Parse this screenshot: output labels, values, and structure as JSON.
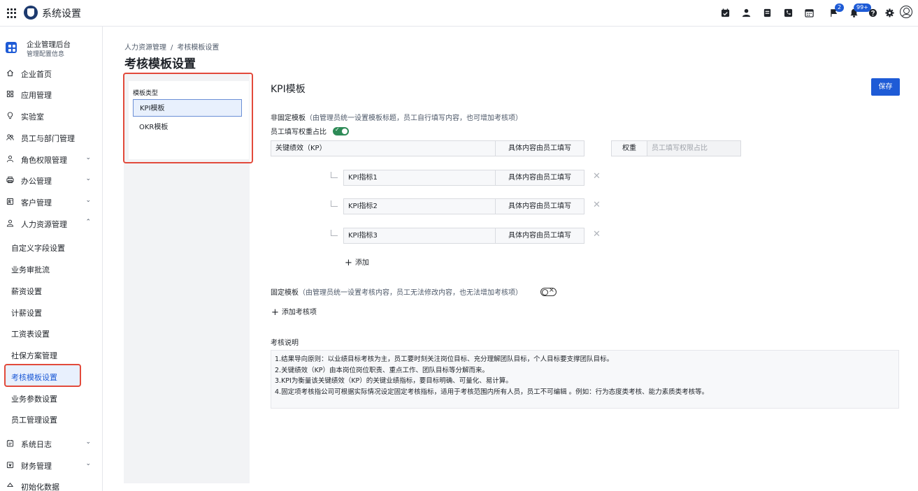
{
  "app": {
    "title": "系统设置"
  },
  "topbar": {
    "icons": [
      "calendar-check-icon",
      "person-icon",
      "document-icon",
      "phone-icon",
      "calendar-grid-icon",
      "flag-icon",
      "bell-icon",
      "help-icon",
      "gear-icon",
      "avatar-icon"
    ],
    "flag_badge": "2",
    "bell_badge": "99+"
  },
  "sidebar": {
    "org_name": "企业管理后台",
    "org_sub": "管理配置信息",
    "items": [
      {
        "label": "企业首页",
        "icon": "home-icon",
        "chevron": ""
      },
      {
        "label": "应用管理",
        "icon": "apps-icon",
        "chevron": ""
      },
      {
        "label": "实验室",
        "icon": "bulb-icon",
        "chevron": ""
      },
      {
        "label": "员工与部门管理",
        "icon": "people-icon",
        "chevron": ""
      },
      {
        "label": "角色权限管理",
        "icon": "role-icon",
        "chevron": "⌄"
      },
      {
        "label": "办公管理",
        "icon": "printer-icon",
        "chevron": "⌄"
      },
      {
        "label": "客户管理",
        "icon": "contact-card-icon",
        "chevron": "⌄"
      },
      {
        "label": "人力资源管理",
        "icon": "hr-icon",
        "chevron": "⌃"
      }
    ],
    "sub_items": [
      {
        "label": "自定义字段设置"
      },
      {
        "label": "业务审批流"
      },
      {
        "label": "薪资设置"
      },
      {
        "label": "计薪设置"
      },
      {
        "label": "工资表设置"
      },
      {
        "label": "社保方案管理"
      },
      {
        "label": "考核模板设置"
      },
      {
        "label": "业务参数设置"
      },
      {
        "label": "员工管理设置"
      }
    ],
    "bottom_items": [
      {
        "label": "系统日志",
        "icon": "log-icon",
        "chevron": "⌄"
      },
      {
        "label": "财务管理",
        "icon": "finance-icon",
        "chevron": "⌄"
      },
      {
        "label": "初始化数据",
        "icon": "init-icon",
        "chevron": ""
      }
    ]
  },
  "breadcrumb": {
    "parent": "人力资源管理",
    "separator": "/",
    "current": "考核模板设置"
  },
  "page_title": "考核模板设置",
  "template_types": {
    "label": "模板类型",
    "options": [
      "KPI模板",
      "OKR模板"
    ]
  },
  "kpi": {
    "title": "KPI模板",
    "save_label": "保存",
    "nonfixed_title": "非固定模板",
    "nonfixed_hint": "（由管理员统一设置模板标题，员工自行填写内容，也可增加考核项）",
    "weight_toggle_label": "员工填写权重占比",
    "key_perf": "关键绩效（KP）",
    "fill_by_employee": "具体内容由员工填写",
    "weight_label": "权重",
    "weight_placeholder": "员工填写权限占比",
    "indicators": [
      "KPI指标1",
      "KPI指标2",
      "KPI指标3"
    ],
    "add_label": "添加",
    "fixed_title": "固定模板",
    "fixed_hint": "（由管理员统一设置考核内容，员工无法修改内容，也无法增加考核项）",
    "add_item_label": "添加考核项",
    "desc_title": "考核说明",
    "desc_lines": [
      "1.结果导向原则：以业绩目标考核为主，员工要时刻关注岗位目标、充分理解团队目标，个人目标要支撑团队目标。",
      "2.关键绩效（KP）由本岗位岗位职责、重点工作、团队目标等分解而来。",
      "3.KPI为衡量该关键绩效（KP）的关键业绩指标，要目标明确、可量化、易计算。",
      "4.固定项考核指公司可根据实际情况设定固定考核指标，适用于考核范围内所有人员，员工不可编辑 。例如：行为态度类考核、能力素质类考核等。"
    ]
  }
}
